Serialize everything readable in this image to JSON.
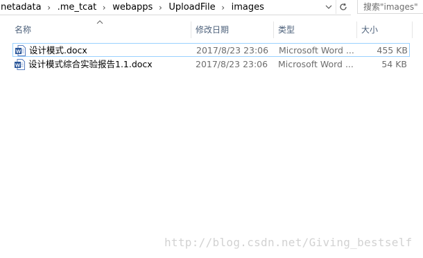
{
  "address_bar": {
    "crumbs": [
      "netadata",
      ".me_tcat",
      "webapps",
      "UploadFile",
      "images"
    ],
    "separator": "›"
  },
  "search": {
    "placeholder": "搜索\"images\""
  },
  "columns": {
    "name": "名称",
    "date": "修改日期",
    "type": "类型",
    "size": "大小"
  },
  "files": [
    {
      "name": "设计模式.docx",
      "date": "2017/8/23 23:06",
      "type": "Microsoft Word ...",
      "size": "455 KB",
      "icon": "word-doc-icon",
      "selected": true
    },
    {
      "name": "设计模式综合实验报告1.1.docx",
      "date": "2017/8/23 23:06",
      "type": "Microsoft Word ...",
      "size": "54 KB",
      "icon": "word-doc-icon",
      "selected": false
    }
  ],
  "watermark": "http://blog.csdn.net/Giving_bestself",
  "colors": {
    "selection_border": "#99d1ff",
    "header_text": "#4c607a",
    "word_blue": "#2b579a"
  }
}
